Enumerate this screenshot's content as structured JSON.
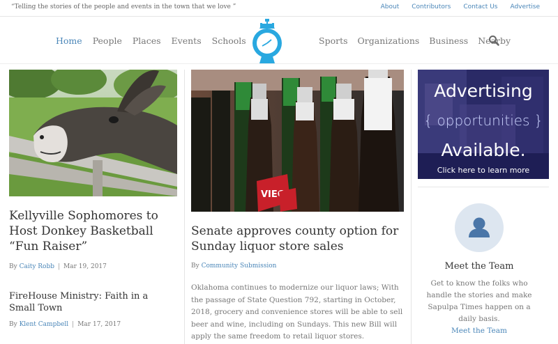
{
  "topbar": {
    "tagline": "“Telling the stories of the people and events in the town that we love ”",
    "links": [
      "About",
      "Contributors",
      "Contact Us",
      "Advertise"
    ]
  },
  "nav": {
    "left": [
      "Home",
      "People",
      "Places",
      "Events",
      "Schools"
    ],
    "right": [
      "Sports",
      "Organizations",
      "Business",
      "Nearby"
    ],
    "active": "Home"
  },
  "articles": [
    {
      "title": "Kellyville Sophomores to Host Donkey Basketball “Fun Raiser”",
      "author": "Caity Robb",
      "date": "Mar 19, 2017"
    },
    {
      "title": "FireHouse Ministry: Faith in a Small Town",
      "author": "Klent Campbell",
      "date": "Mar 17, 2017"
    },
    {
      "title": "Senate approves county option for Sunday liquor store sales",
      "author": "Community Submission",
      "excerpt": "Oklahoma continues to modernize our liquor laws; With the passage of State Question 792, starting in October, 2018, grocery and convenience stores will be able to sell beer and wine, including on Sundays. This new Bill will apply the same freedom to retail liquor stores.",
      "bottle_label": "VIEC"
    }
  ],
  "byline_prefix": "By",
  "ad": {
    "line1": "Advertising",
    "line2": "{ opportunities }",
    "line3": "Available.",
    "line4": "Click here to learn more"
  },
  "team": {
    "title": "Meet the Team",
    "description": "Get to know the folks who handle the stories and make Sapulpa Times happen on a daily basis.",
    "link": "Meet the Team"
  },
  "colors": {
    "accent": "#4a86b8",
    "logo": "#29a8e0"
  },
  "icons": [
    "search-icon",
    "clock-tower-logo",
    "user-icon"
  ]
}
